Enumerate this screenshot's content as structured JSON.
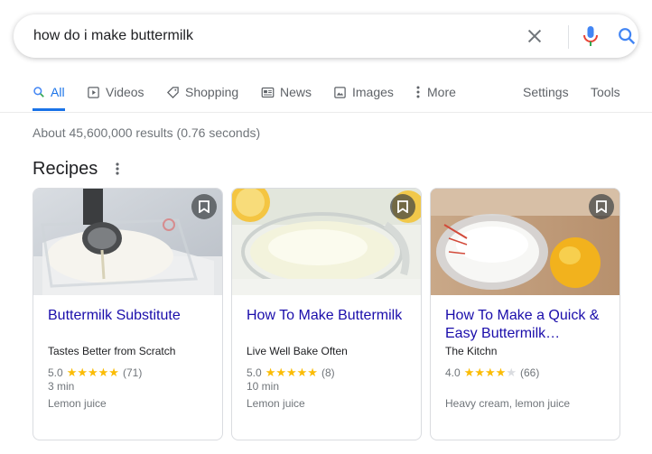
{
  "search": {
    "query": "how do i make buttermilk"
  },
  "tabs": [
    {
      "label": "All",
      "icon": "search-icon",
      "active": true
    },
    {
      "label": "Videos",
      "icon": "video-icon"
    },
    {
      "label": "Shopping",
      "icon": "tag-icon"
    },
    {
      "label": "News",
      "icon": "news-icon"
    },
    {
      "label": "Images",
      "icon": "image-icon"
    },
    {
      "label": "More",
      "icon": "more-vert-icon"
    },
    {
      "label": "Settings"
    },
    {
      "label": "Tools"
    }
  ],
  "result_stats": "About 45,600,000 results (0.76 seconds)",
  "recipes": {
    "heading": "Recipes",
    "cards": [
      {
        "title": "Buttermilk Substitute",
        "source": "Tastes Better from Scratch",
        "rating": "5.0",
        "stars": 5,
        "reviews": "(71)",
        "time": "3 min",
        "ingredients": "Lemon juice"
      },
      {
        "title": "How To Make Buttermilk",
        "source": "Live Well Bake Often",
        "rating": "5.0",
        "stars": 5,
        "reviews": "(8)",
        "time": "10 min",
        "ingredients": "Lemon juice"
      },
      {
        "title": "How To Make a Quick & Easy Buttermilk…",
        "source": "The Kitchn",
        "rating": "4.0",
        "stars": 4,
        "reviews": "(66)",
        "time": "",
        "ingredients": "Heavy cream, lemon juice"
      }
    ]
  },
  "colors": {
    "link": "#1a0dab",
    "accent": "#1a73e8",
    "star": "#fbbc04"
  }
}
